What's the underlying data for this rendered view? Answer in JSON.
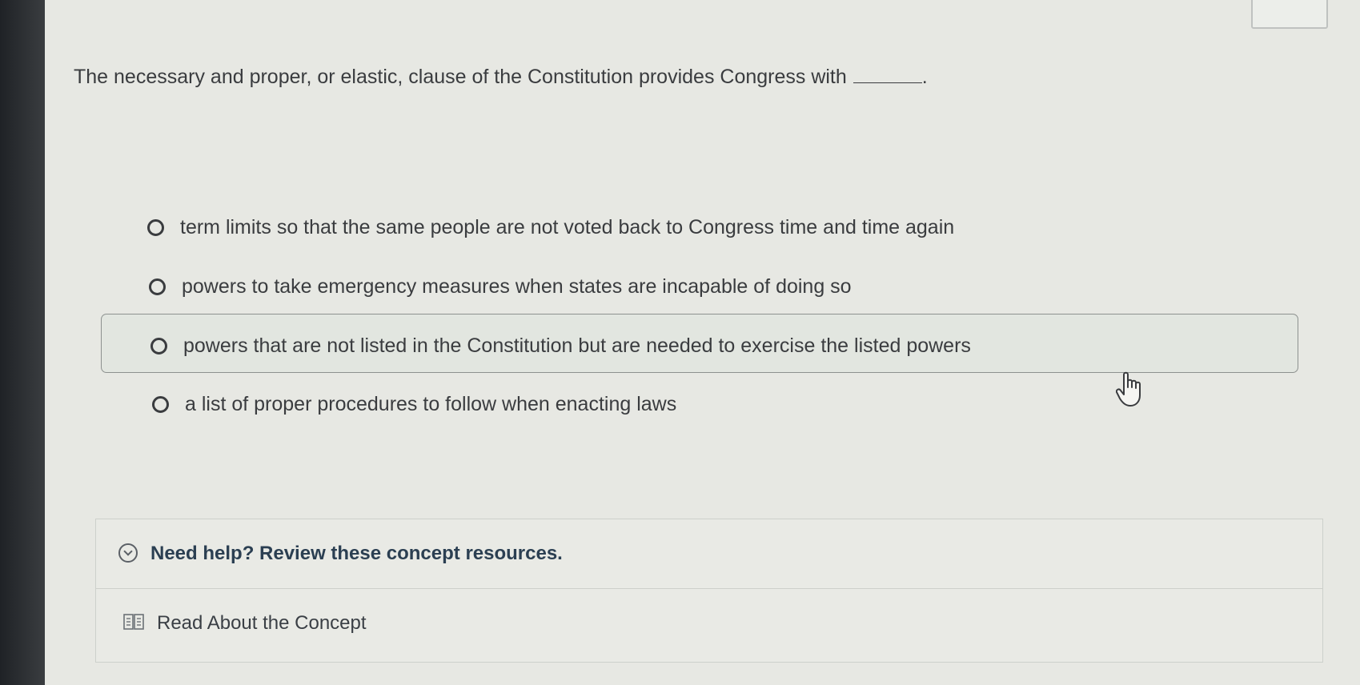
{
  "question": {
    "text": "The necessary and proper, or elastic, clause of the Constitution provides Congress with",
    "blank_suffix": "."
  },
  "options": [
    {
      "label": "term limits so that the same people are not voted back to Congress time and time again",
      "selected": false
    },
    {
      "label": "powers to take emergency measures when states are incapable of doing so",
      "selected": false
    },
    {
      "label": "powers that are not listed in the Constitution but are needed to exercise the listed powers",
      "selected": false,
      "hovered": true
    },
    {
      "label": "a list of proper procedures to follow when enacting laws",
      "selected": false
    }
  ],
  "help": {
    "title": "Need help? Review these concept resources.",
    "icon": "chevron-down-circle-icon",
    "resources": [
      {
        "label": "Read About the Concept",
        "icon": "book-icon"
      }
    ]
  },
  "colors": {
    "page_background": "#e7e8e3",
    "help_title": "#2b3f52",
    "hover_border": "#8d918f"
  }
}
